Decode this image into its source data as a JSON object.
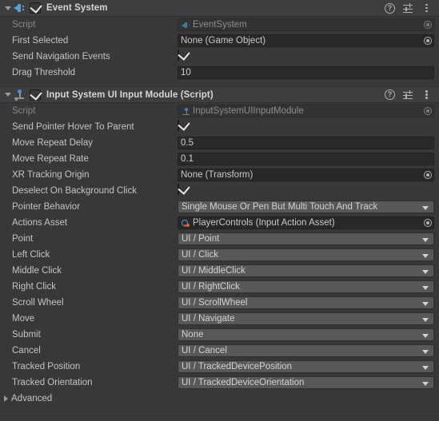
{
  "components": [
    {
      "id": "event-system",
      "title": "Event System",
      "icon": "event-system-icon",
      "enabled": true,
      "expanded": true,
      "header_tools": [
        "help-icon",
        "preset-icon",
        "kebab-icon"
      ],
      "rows": [
        {
          "label": "Script",
          "dim": true,
          "type": "object",
          "value": "EventSystem",
          "readonly": true,
          "icon": "script-eventsystem-icon"
        },
        {
          "label": "First Selected",
          "dim": false,
          "type": "object",
          "value": "None (Game Object)",
          "readonly": false,
          "icon": null
        },
        {
          "label": "Send Navigation Events",
          "dim": false,
          "type": "checkbox",
          "value": true
        },
        {
          "label": "Drag Threshold",
          "dim": false,
          "type": "text",
          "value": "10"
        }
      ]
    },
    {
      "id": "input-system-ui-input-module",
      "title": "Input System UI Input Module (Script)",
      "icon": "input-system-icon",
      "enabled": true,
      "expanded": true,
      "header_tools": [
        "help-icon",
        "preset-icon",
        "kebab-icon"
      ],
      "rows": [
        {
          "label": "Script",
          "dim": true,
          "type": "object",
          "value": "InputSystemUIInputModule",
          "readonly": true,
          "icon": "script-inputsystem-icon"
        },
        {
          "label": "Send Pointer Hover To Parent",
          "dim": false,
          "type": "checkbox",
          "value": true
        },
        {
          "label": "Move Repeat Delay",
          "dim": false,
          "type": "text",
          "value": "0.5"
        },
        {
          "label": "Move Repeat Rate",
          "dim": false,
          "type": "text",
          "value": "0.1"
        },
        {
          "label": "XR Tracking Origin",
          "dim": false,
          "type": "object",
          "value": "None (Transform)",
          "readonly": false,
          "icon": null
        },
        {
          "label": "Deselect On Background Click",
          "dim": false,
          "type": "checkbox",
          "value": true
        },
        {
          "label": "Pointer Behavior",
          "dim": false,
          "type": "dropdown",
          "value": "Single Mouse Or Pen But Multi Touch And Track"
        },
        {
          "label": "Actions Asset",
          "dim": false,
          "type": "object",
          "value": "PlayerControls (Input Action Asset)",
          "readonly": false,
          "icon": "input-action-asset-icon"
        },
        {
          "label": "Point",
          "dim": false,
          "type": "dropdown",
          "value": "UI / Point"
        },
        {
          "label": "Left Click",
          "dim": false,
          "type": "dropdown",
          "value": "UI / Click"
        },
        {
          "label": "Middle Click",
          "dim": false,
          "type": "dropdown",
          "value": "UI / MiddleClick"
        },
        {
          "label": "Right Click",
          "dim": false,
          "type": "dropdown",
          "value": "UI / RightClick"
        },
        {
          "label": "Scroll Wheel",
          "dim": false,
          "type": "dropdown",
          "value": "UI / ScrollWheel"
        },
        {
          "label": "Move",
          "dim": false,
          "type": "dropdown",
          "value": "UI / Navigate"
        },
        {
          "label": "Submit",
          "dim": false,
          "type": "dropdown",
          "value": "None"
        },
        {
          "label": "Cancel",
          "dim": false,
          "type": "dropdown",
          "value": "UI / Cancel"
        },
        {
          "label": "Tracked Position",
          "dim": false,
          "type": "dropdown",
          "value": "UI / TrackedDevicePosition"
        },
        {
          "label": "Tracked Orientation",
          "dim": false,
          "type": "dropdown",
          "value": "UI / TrackedDeviceOrientation"
        },
        {
          "label": "Advanced",
          "dim": false,
          "type": "foldout",
          "expanded": false
        }
      ]
    }
  ],
  "colors": {
    "background": "#383838",
    "header_background": "#3e3e3e",
    "dropdown_background": "#585858",
    "textfield_background": "#2a2a2a",
    "objectfield_background": "#282828",
    "label": "#c4c4c4",
    "label_dim": "#878787",
    "accent_blue": "#4ea4d8",
    "accent_orange": "#d46a2a",
    "separator": "#303030"
  }
}
